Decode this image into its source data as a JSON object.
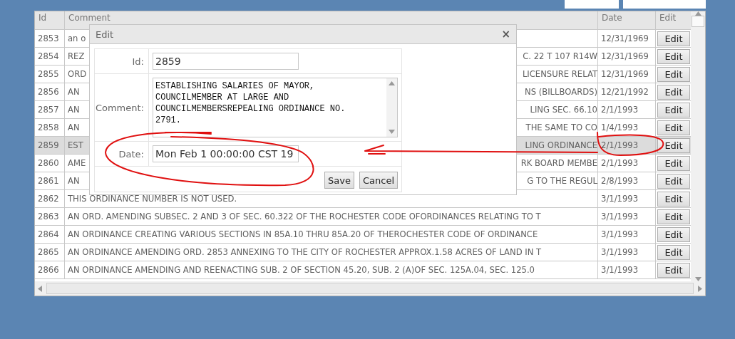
{
  "table": {
    "columns": [
      "Id",
      "Comment",
      "Date",
      "Edit"
    ],
    "rows": [
      {
        "id": "2853",
        "comment_parts": [
          "an o"
        ],
        "date": "12/31/1969",
        "action": "Edit",
        "selected": false
      },
      {
        "id": "2854",
        "comment_parts": [
          "REZ",
          "C. 22 T 107 R14W"
        ],
        "date": "12/31/1969",
        "action": "Edit",
        "selected": false
      },
      {
        "id": "2855",
        "comment_parts": [
          "ORD",
          "LICENSURE RELAT"
        ],
        "date": "12/31/1969",
        "action": "Edit",
        "selected": false
      },
      {
        "id": "2856",
        "comment_parts": [
          "AN",
          "NS (BILLBOARDS)"
        ],
        "date": "12/21/1992",
        "action": "Edit",
        "selected": false
      },
      {
        "id": "2857",
        "comment_parts": [
          "AN",
          "LING SEC. 66.10"
        ],
        "date": "2/1/1993",
        "action": "Edit",
        "selected": false
      },
      {
        "id": "2858",
        "comment_parts": [
          "AN",
          "THE SAME TO CO"
        ],
        "date": "1/4/1993",
        "action": "Edit",
        "selected": false
      },
      {
        "id": "2859",
        "comment_parts": [
          "EST",
          "LING ORDINANCE"
        ],
        "date": "2/1/1993",
        "action": "Edit",
        "selected": true
      },
      {
        "id": "2860",
        "comment_parts": [
          "AME",
          "RK BOARD MEMBE"
        ],
        "date": "2/1/1993",
        "action": "Edit",
        "selected": false
      },
      {
        "id": "2861",
        "comment_parts": [
          "AN",
          "G TO THE REGUL"
        ],
        "date": "2/8/1993",
        "action": "Edit",
        "selected": false
      },
      {
        "id": "2862",
        "comment_parts": [
          "THIS ORDINANCE NUMBER IS NOT USED."
        ],
        "date": "3/1/1993",
        "action": "Edit",
        "selected": false
      },
      {
        "id": "2863",
        "comment_parts": [
          "AN ORD. AMENDING SUBSEC. 2 AND 3 OF SEC. 60.322 OF THE ROCHESTER CODE OFORDINANCES RELATING TO T"
        ],
        "date": "3/1/1993",
        "action": "Edit",
        "selected": false
      },
      {
        "id": "2864",
        "comment_parts": [
          "AN ORDINANCE CREATING VARIOUS SECTIONS IN 85A.10 THRU 85A.20 OF THEROCHESTER CODE OF ORDINANCE"
        ],
        "date": "3/1/1993",
        "action": "Edit",
        "selected": false
      },
      {
        "id": "2865",
        "comment_parts": [
          "AN ORDINANCE AMENDING ORD. 2853 ANNEXING TO THE CITY OF ROCHESTER APPROX.1.58 ACRES OF LAND IN T"
        ],
        "date": "3/1/1993",
        "action": "Edit",
        "selected": false
      },
      {
        "id": "2866",
        "comment_parts": [
          "AN ORDINANCE AMENDING AND REENACTING SUB. 2 OF SECTION 45.20, SUB. 2 (A)OF SEC. 125A.04, SEC. 125.0"
        ],
        "date": "3/1/1993",
        "action": "Edit",
        "selected": false
      }
    ]
  },
  "dialog": {
    "title": "Edit",
    "close": "×",
    "fields": [
      {
        "label": "Id:",
        "kind": "input",
        "value": "2859"
      },
      {
        "label": "Comment:",
        "kind": "textarea",
        "value": "ESTABLISHING SALARIES OF MAYOR,\nCOUNCILMEMBER AT LARGE AND\nCOUNCILMEMBERSREPEALING ORDINANCE NO.\n2791."
      },
      {
        "label": "Date:",
        "kind": "input",
        "value": "Mon Feb 1 00:00:00 CST 19"
      }
    ],
    "buttons": [
      "Save",
      "Cancel"
    ]
  }
}
